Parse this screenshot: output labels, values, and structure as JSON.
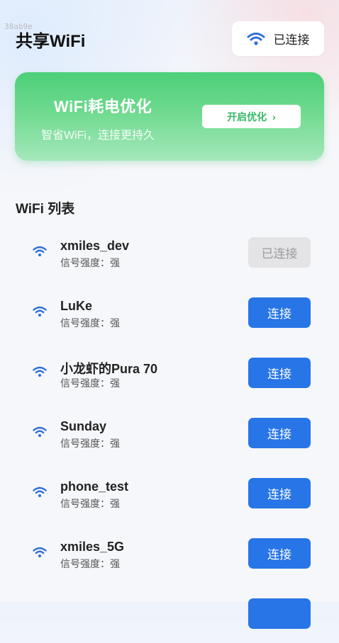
{
  "watermark": "38ab9e",
  "header": {
    "title": "共享WiFi",
    "status_label": "已连接"
  },
  "banner": {
    "title": "WiFi耗电优化",
    "subtitle": "智省WiFi，连接更持久",
    "button_label": "开启优化",
    "button_chevron": "›"
  },
  "section": {
    "title": "WiFi 列表"
  },
  "networks": [
    {
      "name": "xmiles_dev",
      "signal": "信号强度：强",
      "action": "已连接",
      "connected": true
    },
    {
      "name": "LuKe",
      "signal": "信号强度：强",
      "action": "连接",
      "connected": false
    },
    {
      "name": "小龙虾的Pura 70",
      "signal": "信号强度：强",
      "action": "连接",
      "connected": false
    },
    {
      "name": "Sunday",
      "signal": "信号强度：强",
      "action": "连接",
      "connected": false
    },
    {
      "name": "phone_test",
      "signal": "信号强度：强",
      "action": "连接",
      "connected": false
    },
    {
      "name": "xmiles_5G",
      "signal": "信号强度：强",
      "action": "连接",
      "connected": false
    },
    {
      "name": "",
      "signal": "",
      "action": "",
      "connected": false
    }
  ],
  "colors": {
    "accent": "#2775e6",
    "banner_green": "#4ccf78",
    "wifi_icon": "#2f6fd6"
  }
}
